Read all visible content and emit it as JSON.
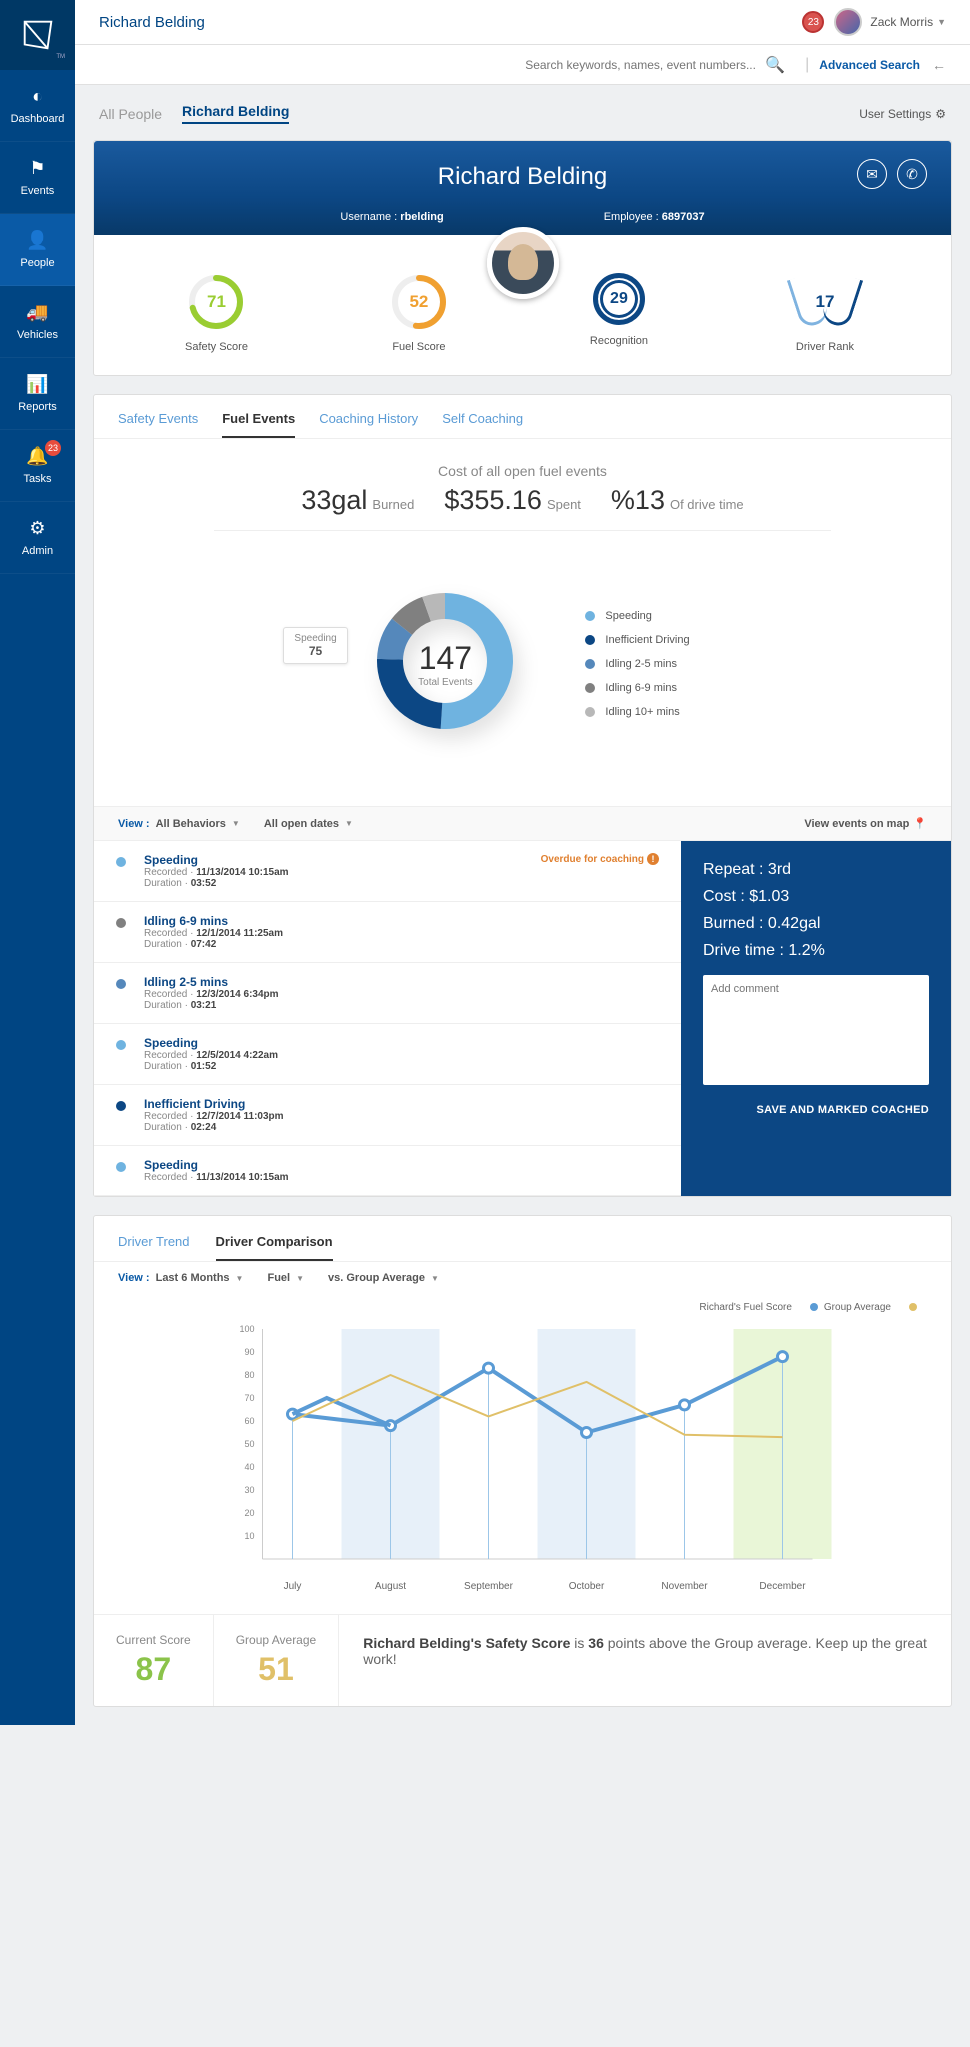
{
  "header": {
    "page_title": "Richard Belding",
    "notif_count": "23",
    "user_name": "Zack Morris",
    "search_placeholder": "Search keywords, names, event numbers...",
    "advanced_search": "Advanced Search"
  },
  "sidebar": {
    "items": [
      {
        "label": "Dashboard",
        "icon": "◐"
      },
      {
        "label": "Events",
        "icon": "⚑"
      },
      {
        "label": "People",
        "icon": "👤"
      },
      {
        "label": "Vehicles",
        "icon": "🚚"
      },
      {
        "label": "Reports",
        "icon": "📊"
      },
      {
        "label": "Tasks",
        "icon": "🔔",
        "badge": "23"
      },
      {
        "label": "Admin",
        "icon": "⚙"
      }
    ],
    "active_index": 2
  },
  "crumbs": {
    "all": "All People",
    "current": "Richard Belding",
    "settings": "User Settings"
  },
  "profile": {
    "name": "Richard Belding",
    "username_label": "Username :",
    "username": "rbelding",
    "employee_label": "Employee :",
    "employee": "6897037",
    "scores": [
      {
        "label": "Safety Score",
        "value": "71",
        "color": "#9acd32"
      },
      {
        "label": "Fuel Score",
        "value": "52",
        "color": "#f0a030"
      },
      {
        "label": "Recognition",
        "value": "29"
      },
      {
        "label": "Driver Rank",
        "value": "17"
      }
    ]
  },
  "tabs": [
    "Safety Events",
    "Fuel Events",
    "Coaching History",
    "Self Coaching"
  ],
  "tabs_active": 1,
  "fuel_summary": {
    "title": "Cost of all  open fuel events",
    "burned_val": "33gal",
    "burned_lbl": "Burned",
    "spent_val": "$355.16",
    "spent_lbl": "Spent",
    "pct_val": "%13",
    "pct_lbl": "Of drive time"
  },
  "donut": {
    "total": "147",
    "total_label": "Total Events",
    "tooltip": {
      "name": "Speeding",
      "value": "75"
    },
    "legend": [
      {
        "label": "Speeding",
        "color": "#6fb3e0"
      },
      {
        "label": "Inefficient Driving",
        "color": "#0c4784"
      },
      {
        "label": "Idling 2-5 mins",
        "color": "#5588bb"
      },
      {
        "label": "Idling 6-9 mins",
        "color": "#808080"
      },
      {
        "label": "Idling 10+ mins",
        "color": "#b8b8b8"
      }
    ]
  },
  "chart_data": {
    "type": "donut",
    "title": "Total Events",
    "total": 147,
    "series": [
      {
        "name": "Speeding",
        "value": 75,
        "color": "#6fb3e0"
      },
      {
        "name": "Inefficient Driving",
        "value": 36,
        "color": "#0c4784"
      },
      {
        "name": "Idling 2-5 mins",
        "value": 15,
        "color": "#5588bb"
      },
      {
        "name": "Idling 6-9 mins",
        "value": 13,
        "color": "#808080"
      },
      {
        "name": "Idling 10+ mins",
        "value": 8,
        "color": "#b8b8b8"
      }
    ]
  },
  "filters": {
    "view_label": "View :",
    "f1": "All Behaviors",
    "f2": "All open dates",
    "map": "View events on map"
  },
  "events": [
    {
      "title": "Speeding",
      "recorded": "11/13/2014 10:15am",
      "duration": "03:52",
      "color": "#6fb3e0",
      "overdue": "Overdue for coaching"
    },
    {
      "title": "Idling 6-9 mins",
      "recorded": "12/1/2014 11:25am",
      "duration": "07:42",
      "color": "#808080"
    },
    {
      "title": "Idling 2-5 mins",
      "recorded": "12/3/2014 6:34pm",
      "duration": "03:21",
      "color": "#5588bb"
    },
    {
      "title": "Speeding",
      "recorded": "12/5/2014 4:22am",
      "duration": "01:52",
      "color": "#6fb3e0"
    },
    {
      "title": "Inefficient Driving",
      "recorded": "12/7/2014 11:03pm",
      "duration": "02:24",
      "color": "#0c4784"
    },
    {
      "title": "Speeding",
      "recorded": "11/13/2014 10:15am",
      "duration": "",
      "color": "#6fb3e0"
    }
  ],
  "event_labels": {
    "recorded": "Recorded",
    "duration": "Duration"
  },
  "detail": {
    "rows": [
      {
        "label": "Repeat :",
        "value": "3rd"
      },
      {
        "label": "Cost :",
        "value": "$1.03"
      },
      {
        "label": "Burned :",
        "value": "0.42gal"
      },
      {
        "label": "Drive time :",
        "value": "1.2%"
      }
    ],
    "comment_placeholder": "Add comment",
    "save": "SAVE AND MARKED COACHED"
  },
  "comparison": {
    "tabs": [
      "Driver Trend",
      "Driver Comparison"
    ],
    "tabs_active": 1,
    "filters": {
      "view": "View :",
      "f1": "Last 6 Months",
      "f2": "Fuel",
      "f3": "vs. Group Average"
    },
    "legend": [
      {
        "label": "Richard's Fuel Score",
        "color": "#5a9bd5"
      },
      {
        "label": "Group Average",
        "color": "#e0c068"
      }
    ],
    "chart_data": {
      "type": "line",
      "ylabel": "",
      "xlabel": "",
      "ylim": [
        0,
        100
      ],
      "yticks": [
        10,
        20,
        30,
        40,
        50,
        60,
        70,
        80,
        90,
        100
      ],
      "categories": [
        "July",
        "August",
        "September",
        "October",
        "November",
        "December"
      ],
      "series": [
        {
          "name": "Richard's Fuel Score",
          "color": "#5a9bd5",
          "values": [
            63,
            58,
            83,
            55,
            67,
            88
          ]
        },
        {
          "name": "Group Average",
          "color": "#e0c068",
          "values": [
            60,
            80,
            62,
            77,
            54,
            53
          ]
        }
      ],
      "extra_points": {
        "name": "Richard's Fuel Score pre-dip",
        "x": 0.3,
        "y": 70
      }
    },
    "footer": {
      "current_label": "Current Score",
      "current": "87",
      "current_color": "#8bc34a",
      "group_label": "Group Average",
      "group": "51",
      "group_color": "#e0c068",
      "msg_name": "Richard Belding's Safety Score",
      "msg_mid": " is ",
      "msg_pts": "36",
      "msg_rest": " points above the Group average. Keep up the great work!"
    }
  }
}
